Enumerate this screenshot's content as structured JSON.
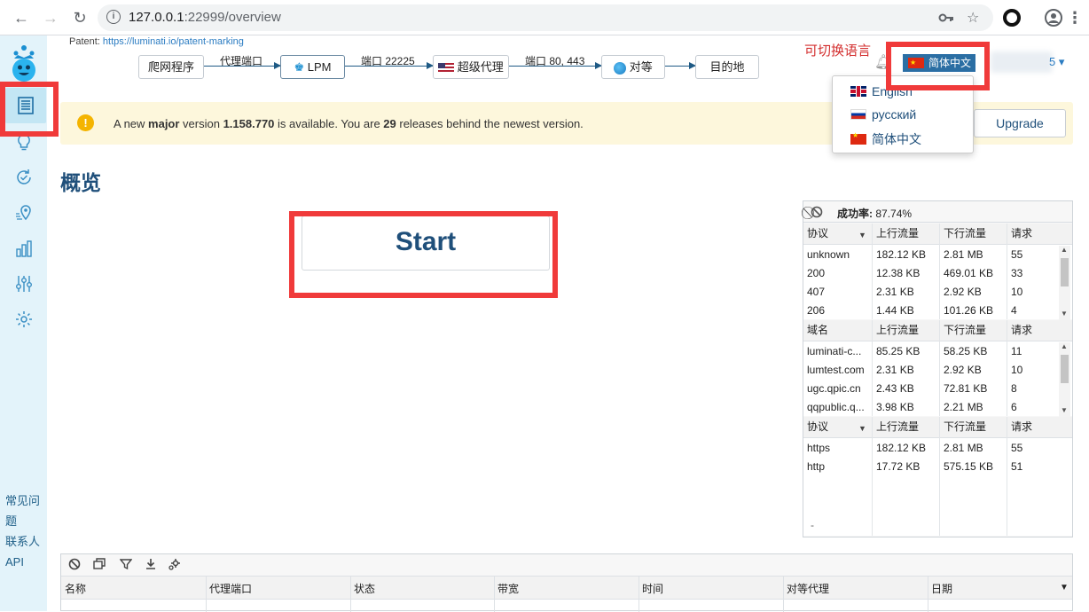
{
  "browser": {
    "url_host": "127.0.0.1",
    "url_rest": ":22999/overview"
  },
  "patent": {
    "prefix": "Patent: ",
    "link": "https://luminati.io/patent-marking"
  },
  "flow": {
    "crawler": "爬网程序",
    "proxy_port_label": "代理端口",
    "lpm": "LPM",
    "port_label_1": "端口 22225",
    "super_proxy": "超级代理",
    "port_label_2": "端口 80, 443",
    "peer": "对等",
    "destination": "目的地"
  },
  "language": {
    "hint": "可切换语言",
    "current": "简体中文",
    "options": [
      "English",
      "русский",
      "简体中文"
    ]
  },
  "banner": {
    "text_1": "A new ",
    "text_major": "major",
    "text_2": " version ",
    "version": "1.158.770",
    "text_3": " is available. You are ",
    "releases": "29",
    "text_4": " releases behind the newest version.",
    "upgrade": "Upgrade"
  },
  "page_title": "概览",
  "start_label": "Start",
  "sidebar_links": [
    "常见问题",
    "联系人",
    "API"
  ],
  "stats": {
    "success_label": "成功率:",
    "success_value": "87.74%",
    "protocol_header": [
      "协议",
      "上行流量",
      "下行流量",
      "请求"
    ],
    "protocol_rows": [
      [
        "unknown",
        "182.12 KB",
        "2.81 MB",
        "55"
      ],
      [
        "200",
        "12.38 KB",
        "469.01 KB",
        "33"
      ],
      [
        "407",
        "2.31 KB",
        "2.92 KB",
        "10"
      ],
      [
        "206",
        "1.44 KB",
        "101.26 KB",
        "4"
      ]
    ],
    "domain_header": [
      "域名",
      "上行流量",
      "下行流量",
      "请求"
    ],
    "domain_rows": [
      [
        "luminati-c...",
        "85.25 KB",
        "58.25 KB",
        "11"
      ],
      [
        "lumtest.com",
        "2.31 KB",
        "2.92 KB",
        "10"
      ],
      [
        "ugc.qpic.cn",
        "2.43 KB",
        "72.81 KB",
        "8"
      ],
      [
        "qqpublic.q...",
        "3.98 KB",
        "2.21 MB",
        "6"
      ]
    ],
    "proto2_header": [
      "协议",
      "上行流量",
      "下行流量",
      "请求"
    ],
    "proto2_rows": [
      [
        "https",
        "182.12 KB",
        "2.81 MB",
        "55"
      ],
      [
        "http",
        "17.72 KB",
        "575.15 KB",
        "51"
      ]
    ],
    "footer": "-"
  },
  "table": {
    "columns": [
      "名称",
      "代理端口",
      "状态",
      "带宽",
      "时间",
      "对等代理",
      "日期"
    ]
  }
}
